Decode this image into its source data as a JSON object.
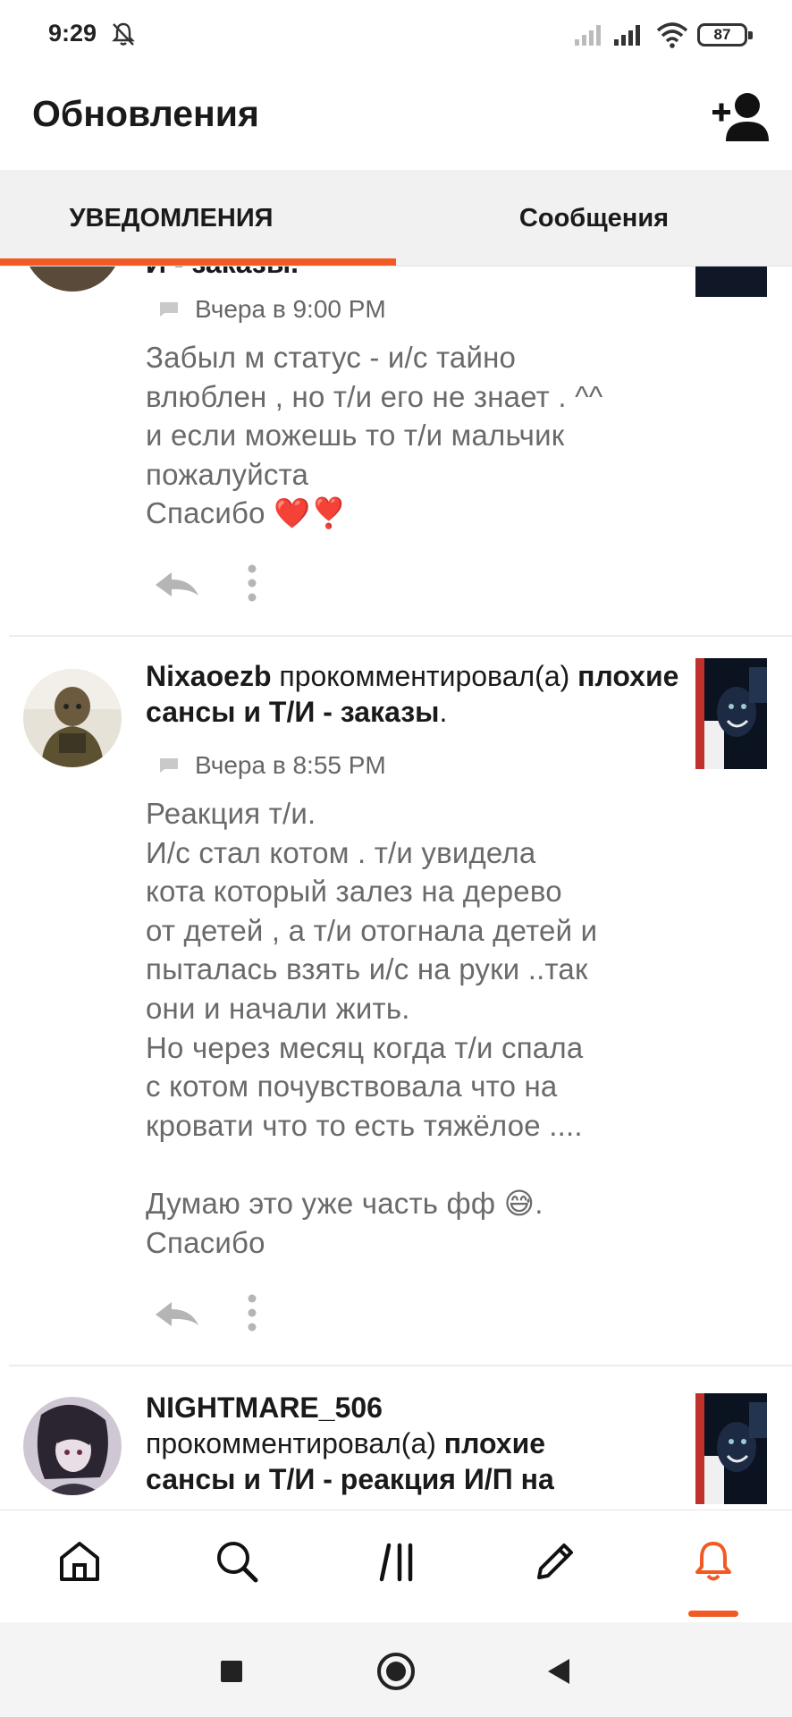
{
  "status_bar": {
    "time": "9:29",
    "battery": "87",
    "icons": [
      "mute-icon",
      "signal-icon",
      "signal-icon",
      "wifi-icon",
      "battery-icon"
    ]
  },
  "header": {
    "title": "Обновления",
    "add_user_icon": "add-user-icon"
  },
  "tabs": [
    {
      "label": "УВЕДОМЛЕНИЯ",
      "active": true
    },
    {
      "label": "Сообщения",
      "active": false
    }
  ],
  "accent_color": "#f15a22",
  "feed": [
    {
      "partial_title": "И - заказы.",
      "time": "Вчера в 9:00 PM",
      "text": "Забыл м статус - и/с  тайно\nвлюблен , но т/и его не знает . ^^\nи если можешь то т/и мальчик\nпожалуйста\nСпасибо ❤️❣️"
    },
    {
      "username": "Nixaoezb",
      "action": "прокомментировал(а)",
      "story": "плохие сансы и Т/И - заказы",
      "story_suffix": ".",
      "time": "Вчера в 8:55 PM",
      "text": "Реакция т/и.\n И/с стал котом . т/и увидела\nкота который залез на дерево\nот детей , а т/и отогнала детей и\nпыталась взять и/с на руки ..так\nони и начали жить.\n Но через месяц когда т/и спала\nс котом почувствовала что на\nкровати что то есть тяжёлое ....\n\nДумаю это уже часть фф 😅.\nСпасибо"
    },
    {
      "username": "NIGHTMARE_506",
      "action": "прокомментировал(а)",
      "story_part1": "плохие",
      "story_part2": "сансы и Т/И - реакция И/П на"
    }
  ],
  "bottom_nav": [
    "home-icon",
    "search-icon",
    "library-icon",
    "write-icon",
    "notifications-icon"
  ],
  "system_nav": [
    "recents-icon",
    "home-circle-icon",
    "back-icon"
  ]
}
